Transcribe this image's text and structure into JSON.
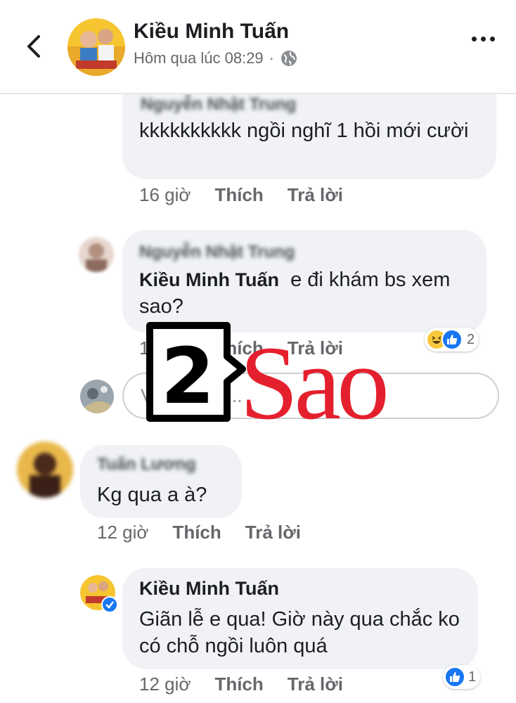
{
  "header": {
    "name": "Kiều Minh Tuấn",
    "timestamp": "Hôm qua lúc 08:29",
    "separator": "·"
  },
  "comments": [
    {
      "name": "Nguyễn Nhật Trung",
      "text": "kkkkkkkkkk ngồi nghĩ 1 hồi mới cười",
      "time": "16 giờ",
      "like_label": "Thích",
      "reply_label": "Trả lời"
    },
    {
      "name": "Nguyễn Nhật Trung",
      "mention": "Kiều Minh Tuấn",
      "text": "e đi khám bs xem sao?",
      "time": "16 giờ",
      "like_label": "Thích",
      "reply_label": "Trả lời",
      "reaction_count": "2"
    },
    {
      "name": "Tuấn Lương",
      "text": "Kg qua a à?",
      "time": "12 giờ",
      "like_label": "Thích",
      "reply_label": "Trả lời"
    },
    {
      "name": "Kiều Minh Tuấn",
      "text": "Giãn lễ e qua! Giờ này qua chắc ko có chỗ ngồi luôn quá",
      "time": "12 giờ",
      "like_label": "Thích",
      "reply_label": "Trả lời",
      "reaction_count": "1"
    }
  ],
  "reply_input": {
    "placeholder": "Viết trả lời..."
  },
  "watermark": {
    "number": "2",
    "text": "Sao"
  },
  "colors": {
    "facebook_blue": "#1877f2",
    "watermark_red": "#e5202e",
    "bubble_gray": "#f0f2f5"
  }
}
